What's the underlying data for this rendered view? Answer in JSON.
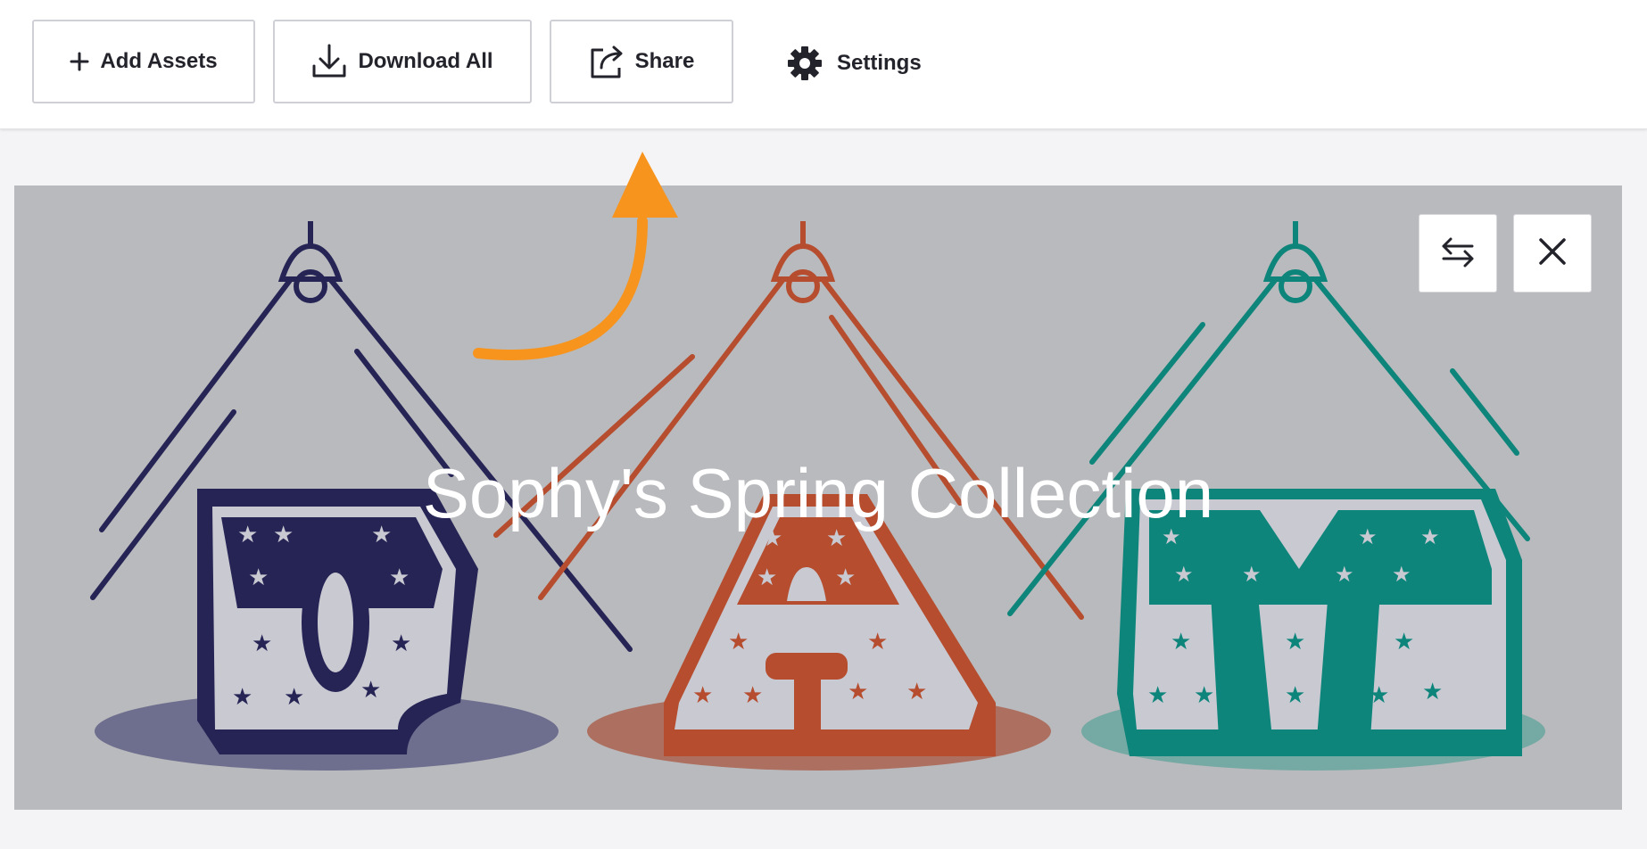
{
  "toolbar": {
    "add_assets": {
      "label": "Add Assets",
      "icon": "plus-icon"
    },
    "download_all": {
      "label": "Download All",
      "icon": "download-icon"
    },
    "share": {
      "label": "Share",
      "icon": "share-icon"
    },
    "settings": {
      "label": "Settings",
      "icon": "gear-icon"
    }
  },
  "banner": {
    "title": "Sophy's Spring Collection",
    "background": "#b9babd",
    "swap_icon": "swap-arrows-icon",
    "close_icon": "close-icon",
    "tent_colors": [
      "#262455",
      "#b54d2e",
      "#0e857b"
    ],
    "tent_letters": [
      "O",
      "A",
      "M"
    ]
  },
  "annotation": {
    "arrow_color": "#f7941d",
    "icon": "curved-arrow-icon"
  }
}
